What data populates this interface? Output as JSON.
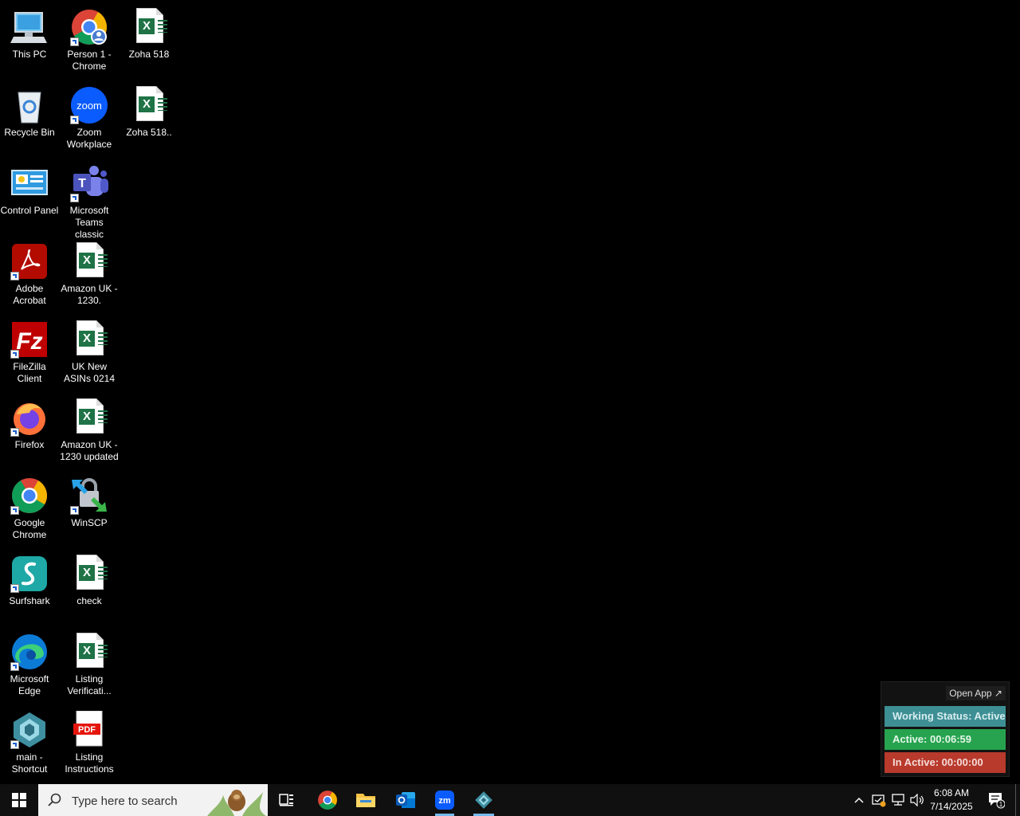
{
  "desktop": {
    "icons": [
      {
        "label": "This PC",
        "icon": "this-pc-icon"
      },
      {
        "label": "Person 1 - Chrome",
        "icon": "chrome-profile-icon"
      },
      {
        "label": "Zoha 518",
        "icon": "excel-file-icon"
      },
      {
        "label": "Recycle Bin",
        "icon": "recycle-bin-icon"
      },
      {
        "label": "Zoom Workplace",
        "icon": "zoom-icon"
      },
      {
        "label": "Zoha 518..",
        "icon": "excel-file-icon"
      },
      {
        "label": "Control Panel",
        "icon": "control-panel-icon"
      },
      {
        "label": "Microsoft Teams classic",
        "icon": "teams-icon"
      },
      {
        "label": "Adobe Acrobat",
        "icon": "acrobat-icon"
      },
      {
        "label": "Amazon UK - 1230.",
        "icon": "excel-file-icon"
      },
      {
        "label": "FileZilla Client",
        "icon": "filezilla-icon"
      },
      {
        "label": "UK New ASINs 0214",
        "icon": "excel-file-icon"
      },
      {
        "label": "Firefox",
        "icon": "firefox-icon"
      },
      {
        "label": "Amazon UK - 1230 updated",
        "icon": "excel-file-icon"
      },
      {
        "label": "Google Chrome",
        "icon": "chrome-icon"
      },
      {
        "label": "WinSCP",
        "icon": "winscp-icon"
      },
      {
        "label": "Surfshark",
        "icon": "surfshark-icon"
      },
      {
        "label": "check",
        "icon": "excel-file-icon"
      },
      {
        "label": "Microsoft Edge",
        "icon": "edge-icon"
      },
      {
        "label": "Listing Verificati...",
        "icon": "excel-file-icon"
      },
      {
        "label": "main - Shortcut",
        "icon": "app-shortcut-icon"
      },
      {
        "label": "Listing Instructions",
        "icon": "pdf-file-icon"
      }
    ],
    "pdf_badge": "PDF",
    "zoom_logo_text": "zoom"
  },
  "widget": {
    "open_app": "Open App ↗",
    "working_status": "Working Status: Active",
    "active": "Active: 00:06:59",
    "inactive": "In Active: 00:00:00",
    "colors": {
      "status": "#3e8f94",
      "active": "#27a34f",
      "inactive": "#b83a2c"
    }
  },
  "taskbar": {
    "search_placeholder": "Type here to search",
    "apps": [
      "start-icon",
      "task-view-icon",
      "chrome-icon",
      "file-explorer-icon",
      "outlook-icon",
      "zoom-icon",
      "app-icon"
    ],
    "zoom_short": "zm",
    "time": "6:08 AM",
    "date": "7/14/2025",
    "notification_count": "1"
  }
}
